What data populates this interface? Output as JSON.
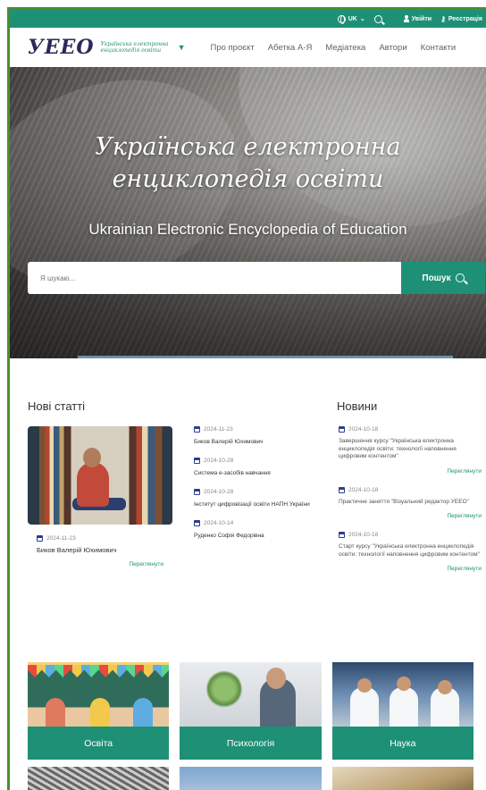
{
  "topbar": {
    "lang": "UK",
    "login": "Увійти",
    "register": "Реєстрація"
  },
  "logo": {
    "word": "УЕЕО",
    "subtitle": "Українська електронна енциклопедія освіти"
  },
  "menu": [
    "Про проєкт",
    "Абетка А-Я",
    "Медіатека",
    "Автори",
    "Контакти"
  ],
  "hero": {
    "title_line1": "Українська електронна",
    "title_line2": "енциклопедія освіти",
    "subtitle": "Ukrainian Electronic Encyclopedia of Education",
    "search_placeholder": "Я шукаю...",
    "search_button": "Пошук"
  },
  "articles": {
    "heading": "Нові статті",
    "featured": {
      "date": "2024-11-23",
      "title": "Биков Валерій Юхимович",
      "more": "Переглянути"
    },
    "items": [
      {
        "date": "2024-11-23",
        "title": "Биков Валерій Юхимович"
      },
      {
        "date": "2024-10-28",
        "title": "Система е-засобів навчання"
      },
      {
        "date": "2024-10-28",
        "title": "Інститут цифровізації освіти НАПН України"
      },
      {
        "date": "2024-10-14",
        "title": "Руденко Софія Федорівна"
      }
    ]
  },
  "news": {
    "heading": "Новини",
    "items": [
      {
        "date": "2024-10-18",
        "title": "Завершення курсу \"Українська електронна енциклопедія освіти: технології наповнення цифровим контентом\"",
        "more": "Переглянути"
      },
      {
        "date": "2024-10-18",
        "title": "Практичне заняття \"Візуальний редактор УЕЕО\"",
        "more": "Переглянути"
      },
      {
        "date": "2024-10-18",
        "title": "Старт курсу \"Українська електронна енциклопедія освіти: технології наповнення цифровим контентом\"",
        "more": "Переглянути"
      }
    ]
  },
  "categories": [
    "Освіта",
    "Психологія",
    "Наука"
  ],
  "colors": {
    "brand": "#1e9075",
    "frame": "#4b8d2f",
    "calendar": "#2a3d8f"
  }
}
